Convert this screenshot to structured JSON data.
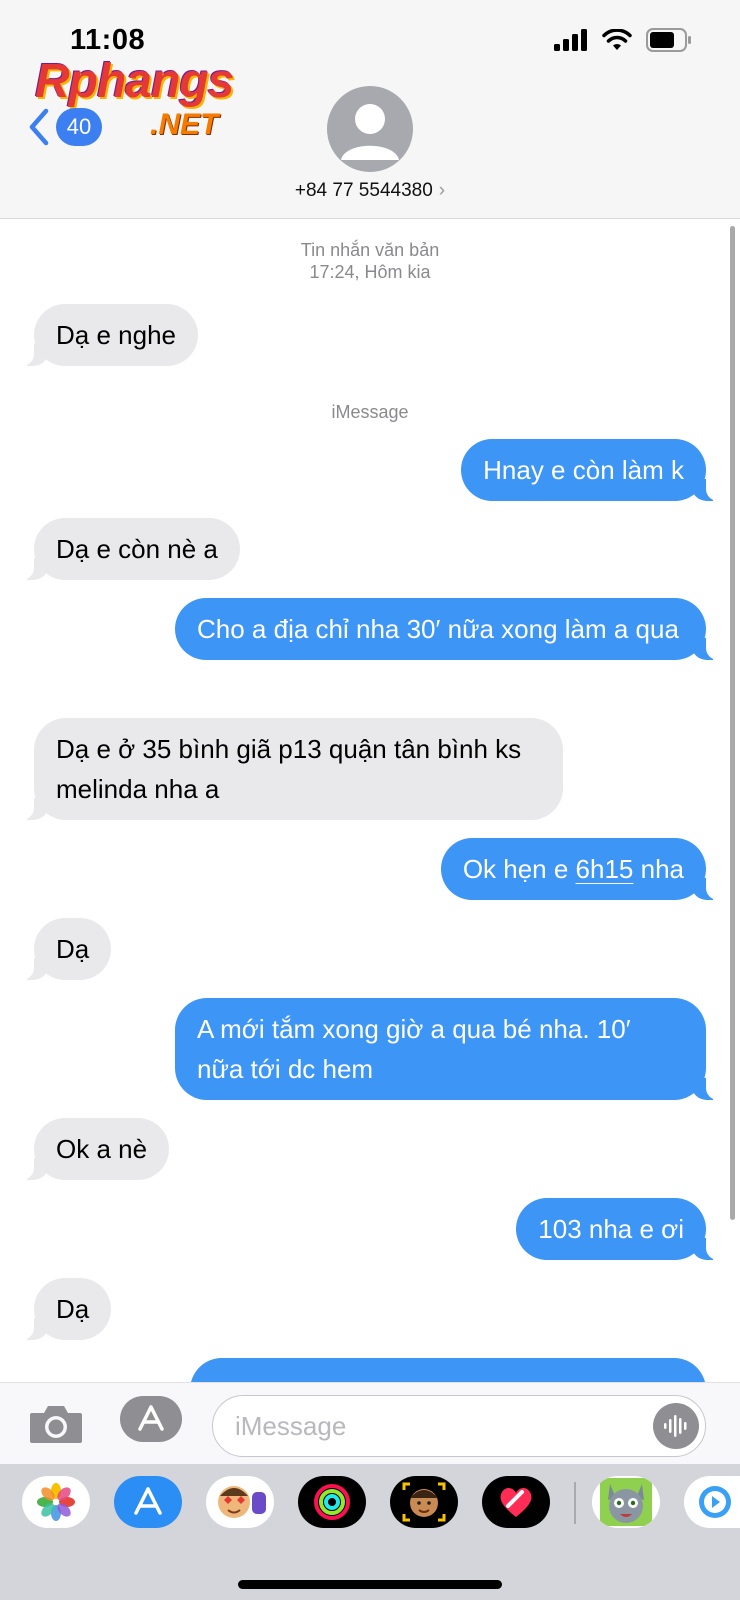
{
  "status_bar": {
    "time": "11:08"
  },
  "watermark": {
    "main": "Rphangs",
    "sub": ".NET"
  },
  "nav": {
    "back_count": "40"
  },
  "contact": {
    "name": "+84 77 5544380",
    "chevron": "›"
  },
  "thread": {
    "service_label": "Tin nhắn văn bản",
    "timestamp": "17:24, Hôm kia",
    "imessage_label": "iMessage",
    "messages": [
      {
        "from": "them",
        "text": "Dạ e nghe"
      },
      {
        "from": "me",
        "text": "Hnay e còn làm k"
      },
      {
        "from": "them",
        "text": "Dạ e còn nè a"
      },
      {
        "from": "me",
        "text": "Cho a địa chỉ nha 30′ nữa xong làm a qua"
      },
      {
        "from": "them",
        "text": "Dạ e ở 35 bình giã p13 quận tân bình ks melinda nha a"
      },
      {
        "from": "me",
        "text_before": "Ok hẹn e ",
        "text_link": "6h15",
        "text_after": " nha"
      },
      {
        "from": "them",
        "text": "Dạ"
      },
      {
        "from": "me",
        "text": "A mới tắm xong giờ a qua bé nha. 10′ nữa tới dc hem"
      },
      {
        "from": "them",
        "text": "Ok a nè"
      },
      {
        "from": "me",
        "text": "103 nha e ơi"
      },
      {
        "from": "them",
        "text": "Dạ"
      }
    ]
  },
  "compose": {
    "placeholder": "iMessage"
  },
  "drawer": {
    "apps": [
      "photos-icon",
      "app-store-icon",
      "memoji-stickers-icon",
      "activity-icon",
      "memoji-icon",
      "digital-touch-icon",
      "talking-tom-icon",
      "music-icon"
    ]
  },
  "colors": {
    "outgoing": "#3d95f6",
    "incoming": "#e9e9eb",
    "badge": "#3b7ff0"
  }
}
